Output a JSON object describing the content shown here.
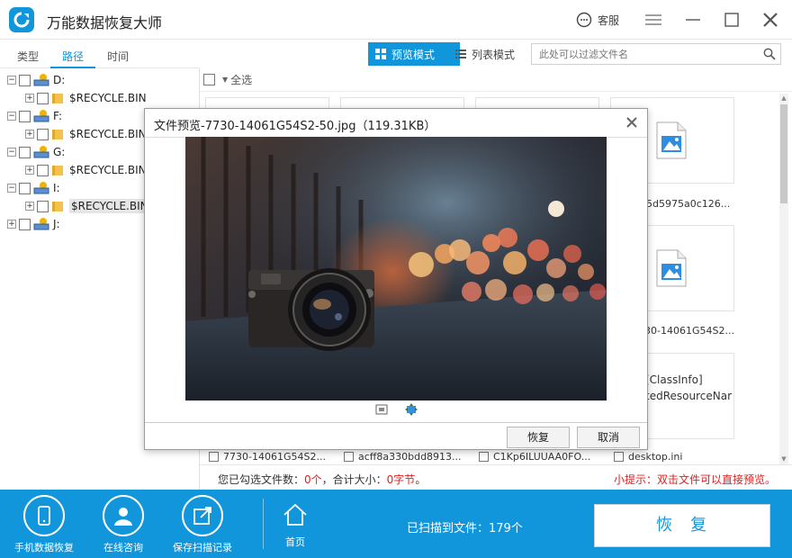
{
  "app": {
    "title": "万能数据恢复大师",
    "support_label": "客服"
  },
  "tabs": [
    {
      "label": "类型"
    },
    {
      "label": "路径"
    },
    {
      "label": "时间"
    }
  ],
  "view_modes": {
    "preview": "预览模式",
    "list": "列表模式"
  },
  "search": {
    "placeholder": "此处可以过滤文件名"
  },
  "tree": {
    "drives": [
      {
        "label": "D:",
        "child": "$RECYCLE.BIN"
      },
      {
        "label": "F:",
        "child": "$RECYCLE.BIN"
      },
      {
        "label": "G:",
        "child": "$RECYCLE.BIN"
      },
      {
        "label": "I:",
        "child": "$RECYCLE.BIN"
      },
      {
        "label": "J:"
      }
    ]
  },
  "content": {
    "select_all": "全选",
    "visible_captions": [
      "5d5975a0c126...",
      "30-14061G54S2...",
      "[ClassInfo]",
      "tedResourceNar"
    ],
    "bottom_files": [
      "7730-14061G54S2...",
      "acff8a330bdd8913...",
      "C1Kp6ILUUAA0FO...",
      "desktop.ini"
    ]
  },
  "status": {
    "selected_prefix": "您已勾选文件数：",
    "selected_count": "0个",
    "size_prefix": "，合计大小：",
    "size_value": "0字节",
    "size_suffix": "。",
    "tip": "小提示：双击文件可以直接预览。"
  },
  "bottom_bar": {
    "phone_recovery": "手机数据恢复",
    "online_consult": "在线咨询",
    "save_scan": "保存扫描记录",
    "home": "首页",
    "scanned_text": "已扫描到文件：179个",
    "recover": "恢复"
  },
  "dialog": {
    "title": "文件预览-7730-14061G54S2-50.jpg（119.31KB）",
    "recover_btn": "恢复",
    "cancel_btn": "取消"
  },
  "colors": {
    "accent": "#1296db",
    "warning": "#e02020"
  }
}
